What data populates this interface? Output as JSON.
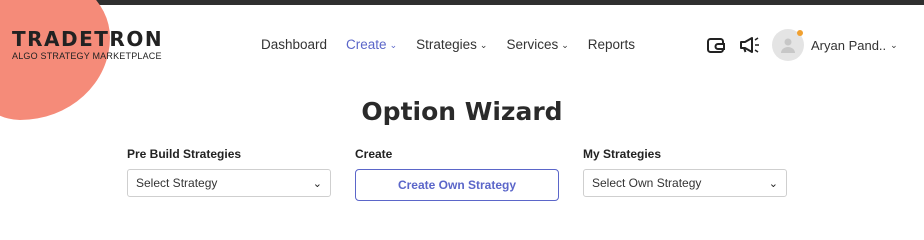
{
  "brand": {
    "title": "TRADETRON",
    "subtitle": "ALGO STRATEGY MARKETPLACE",
    "accent": "#f58b79"
  },
  "nav": [
    {
      "label": "Dashboard",
      "has_dropdown": false
    },
    {
      "label": "Create",
      "has_dropdown": true,
      "active": true
    },
    {
      "label": "Strategies",
      "has_dropdown": true
    },
    {
      "label": "Services",
      "has_dropdown": true
    },
    {
      "label": "Reports",
      "has_dropdown": false
    }
  ],
  "header_icons": [
    "wallet-icon",
    "megaphone-icon"
  ],
  "user": {
    "name": "Aryan Pand..",
    "status_color": "#f0a030"
  },
  "page": {
    "title": "Option Wizard"
  },
  "sections": {
    "prebuild": {
      "label": "Pre Build Strategies",
      "selected": "Select Strategy"
    },
    "create": {
      "label": "Create",
      "button": "Create Own Strategy"
    },
    "mine": {
      "label": "My Strategies",
      "selected": "Select Own Strategy"
    }
  },
  "colors": {
    "primary": "#5b66c9",
    "topbar": "#2f2f2f"
  }
}
